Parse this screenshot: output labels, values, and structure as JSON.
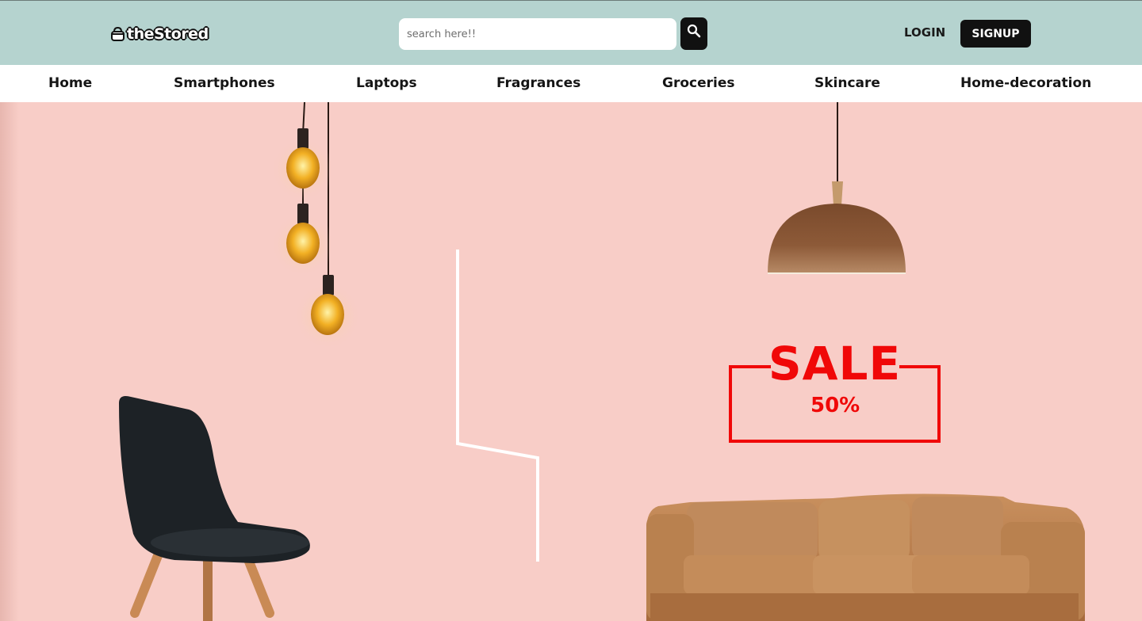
{
  "brand": {
    "name": "theStored",
    "logo_icon": "shopping-bag-icon"
  },
  "search": {
    "placeholder": "search here!!",
    "value": "",
    "button_icon": "search-icon"
  },
  "auth": {
    "login_label": "LOGIN",
    "signup_label": "SIGNUP"
  },
  "nav": {
    "items": [
      {
        "label": "Home"
      },
      {
        "label": "Smartphones"
      },
      {
        "label": "Laptops"
      },
      {
        "label": "Fragrances"
      },
      {
        "label": "Groceries"
      },
      {
        "label": "Skincare"
      },
      {
        "label": "Home-decoration"
      }
    ]
  },
  "hero": {
    "sale_title": "SALE",
    "sale_discount": "50%",
    "images": [
      "hanging-bulbs-image",
      "pendant-lamp-image",
      "chair-image",
      "sofa-image"
    ]
  },
  "colors": {
    "header_bg": "#b5d3cf",
    "hero_bg": "#f8cdc7",
    "sale_red": "#f00808",
    "dark": "#111111"
  }
}
